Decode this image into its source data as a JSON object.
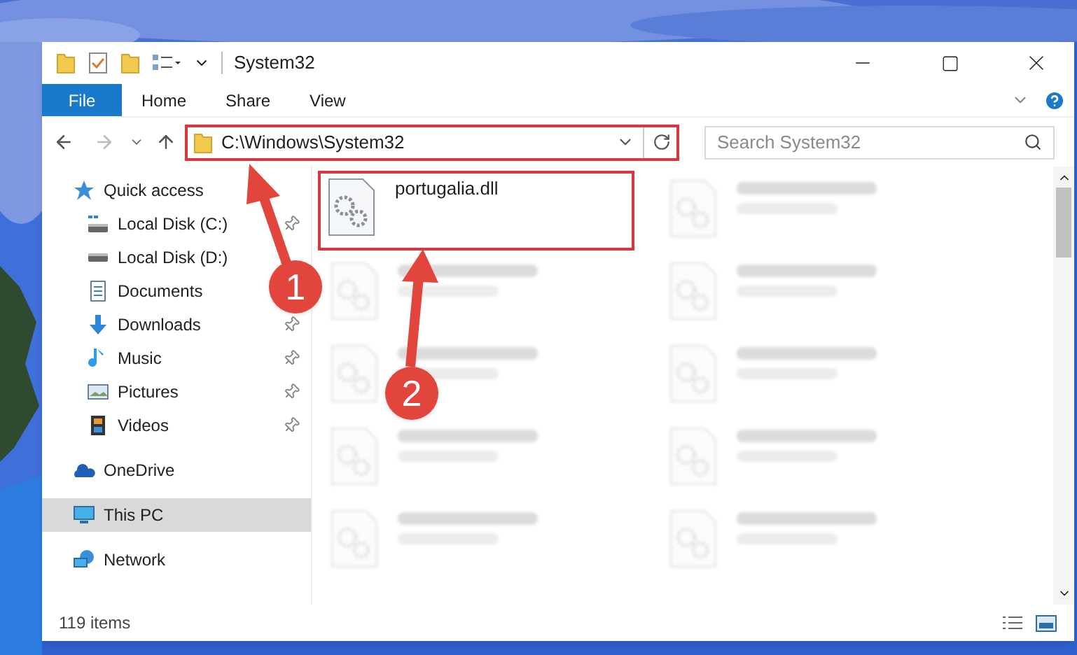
{
  "window": {
    "title": "System32"
  },
  "ribbon_tabs": [
    {
      "label": "File",
      "selected": true
    },
    {
      "label": "Home",
      "selected": false
    },
    {
      "label": "Share",
      "selected": false
    },
    {
      "label": "View",
      "selected": false
    }
  ],
  "address": {
    "path": "C:\\Windows\\System32"
  },
  "search": {
    "placeholder": "Search System32"
  },
  "navigation": [
    {
      "label": "Quick access",
      "kind": "star",
      "selected": false,
      "children": [
        {
          "label": "Local Disk (C:)",
          "kind": "system-drive",
          "pinned": true,
          "selected": false
        },
        {
          "label": "Local Disk (D:)",
          "kind": "drive",
          "pinned": false,
          "selected": false
        },
        {
          "label": "Documents",
          "kind": "documents",
          "pinned": false,
          "selected": false
        },
        {
          "label": "Downloads",
          "kind": "downloads",
          "pinned": true,
          "selected": false
        },
        {
          "label": "Music",
          "kind": "music",
          "pinned": true,
          "selected": false
        },
        {
          "label": "Pictures",
          "kind": "pictures",
          "pinned": true,
          "selected": false
        },
        {
          "label": "Videos",
          "kind": "videos",
          "pinned": true,
          "selected": false
        }
      ]
    },
    {
      "label": "OneDrive",
      "kind": "cloud",
      "selected": false
    },
    {
      "label": "This PC",
      "kind": "computer",
      "selected": true
    },
    {
      "label": "Network",
      "kind": "network",
      "selected": false
    }
  ],
  "files": [
    {
      "name": "portugalia.dll",
      "blurred": false
    },
    {
      "blurred": true
    },
    {
      "blurred": true
    },
    {
      "blurred": true
    },
    {
      "blurred": true
    },
    {
      "blurred": true
    },
    {
      "blurred": true
    },
    {
      "blurred": true
    },
    {
      "blurred": true
    },
    {
      "blurred": true
    }
  ],
  "status_bar": {
    "item_count": "119 items"
  },
  "annotations": [
    {
      "label": "1"
    },
    {
      "label": "2"
    }
  ]
}
